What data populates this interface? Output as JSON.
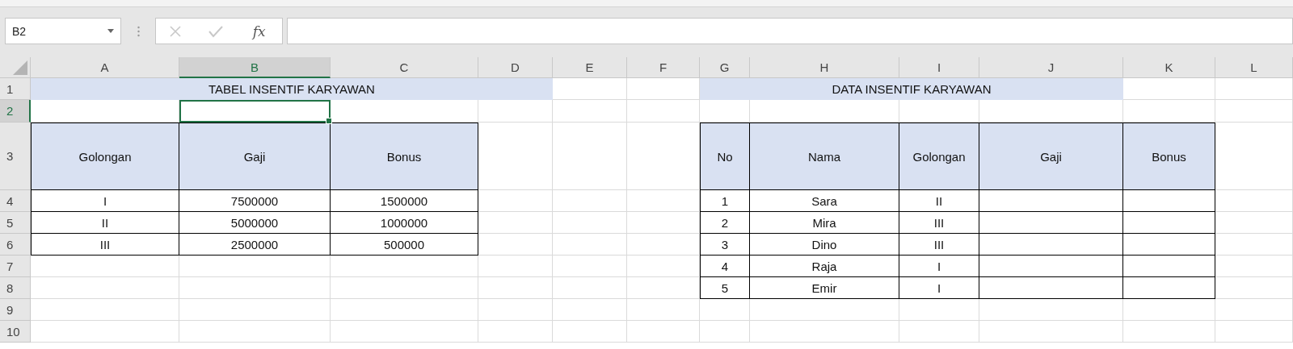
{
  "name_box": {
    "value": "B2"
  },
  "formula_bar": {
    "function_label": "fx",
    "cancel_disabled": true,
    "enter_disabled": true
  },
  "sheet": {
    "columns": [
      {
        "label": "A",
        "selected": false
      },
      {
        "label": "B",
        "selected": true
      },
      {
        "label": "C",
        "selected": false
      },
      {
        "label": "D",
        "selected": false
      },
      {
        "label": "E",
        "selected": false
      },
      {
        "label": "F",
        "selected": false
      },
      {
        "label": "G",
        "selected": false
      },
      {
        "label": "H",
        "selected": false
      },
      {
        "label": "I",
        "selected": false
      },
      {
        "label": "J",
        "selected": false
      },
      {
        "label": "K",
        "selected": false
      },
      {
        "label": "L",
        "selected": false
      }
    ],
    "rows": [
      {
        "label": "1",
        "selected": false
      },
      {
        "label": "2",
        "selected": true
      },
      {
        "label": "3",
        "selected": false
      },
      {
        "label": "4",
        "selected": false
      },
      {
        "label": "5",
        "selected": false
      },
      {
        "label": "6",
        "selected": false
      },
      {
        "label": "7",
        "selected": false
      },
      {
        "label": "8",
        "selected": false
      },
      {
        "label": "9",
        "selected": false
      },
      {
        "label": "10",
        "selected": false
      }
    ],
    "tables": [
      {
        "title": "TABEL INSENTIF KARYAWAN",
        "columns": [
          "Golongan",
          "Gaji",
          "Bonus"
        ],
        "rows": [
          [
            "I",
            "7500000",
            "1500000"
          ],
          [
            "II",
            "5000000",
            "1000000"
          ],
          [
            "III",
            "2500000",
            "500000"
          ]
        ]
      },
      {
        "title": "DATA INSENTIF KARYAWAN",
        "columns": [
          "No",
          "Nama",
          "Golongan",
          "Gaji",
          "Bonus"
        ],
        "rows": [
          [
            "1",
            "Sara",
            "II"
          ],
          [
            "2",
            "Mira",
            "III"
          ],
          [
            "3",
            "Dino",
            "III"
          ],
          [
            "4",
            "Raja",
            "I"
          ],
          [
            "5",
            "Emir",
            "I"
          ]
        ]
      }
    ]
  }
}
